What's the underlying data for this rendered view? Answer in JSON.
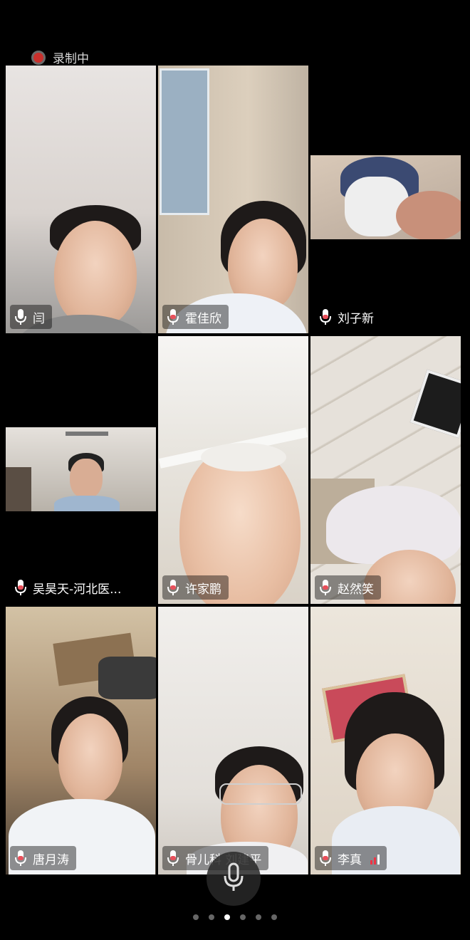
{
  "status": {
    "recording_label": "录制中"
  },
  "participants": [
    {
      "name": "闫",
      "mic": "on"
    },
    {
      "name": "霍佳欣",
      "mic": "on"
    },
    {
      "name": "刘子新",
      "mic": "on"
    },
    {
      "name": "吴昊天-河北医...",
      "mic": "on"
    },
    {
      "name": "许家鹏",
      "mic": "on"
    },
    {
      "name": "赵然笑",
      "mic": "on"
    },
    {
      "name": "唐月涛",
      "mic": "on"
    },
    {
      "name": "骨儿科 刘建平",
      "mic": "on"
    },
    {
      "name": "李真",
      "mic": "on",
      "signal": "weak"
    }
  ],
  "controls": {
    "mic_button_icon": "microphone-icon"
  },
  "pagination": {
    "pages": 6,
    "current": 3
  },
  "colors": {
    "recording": "#c9302c",
    "mic_active": "#e8505b",
    "signal": "#ee3344"
  }
}
